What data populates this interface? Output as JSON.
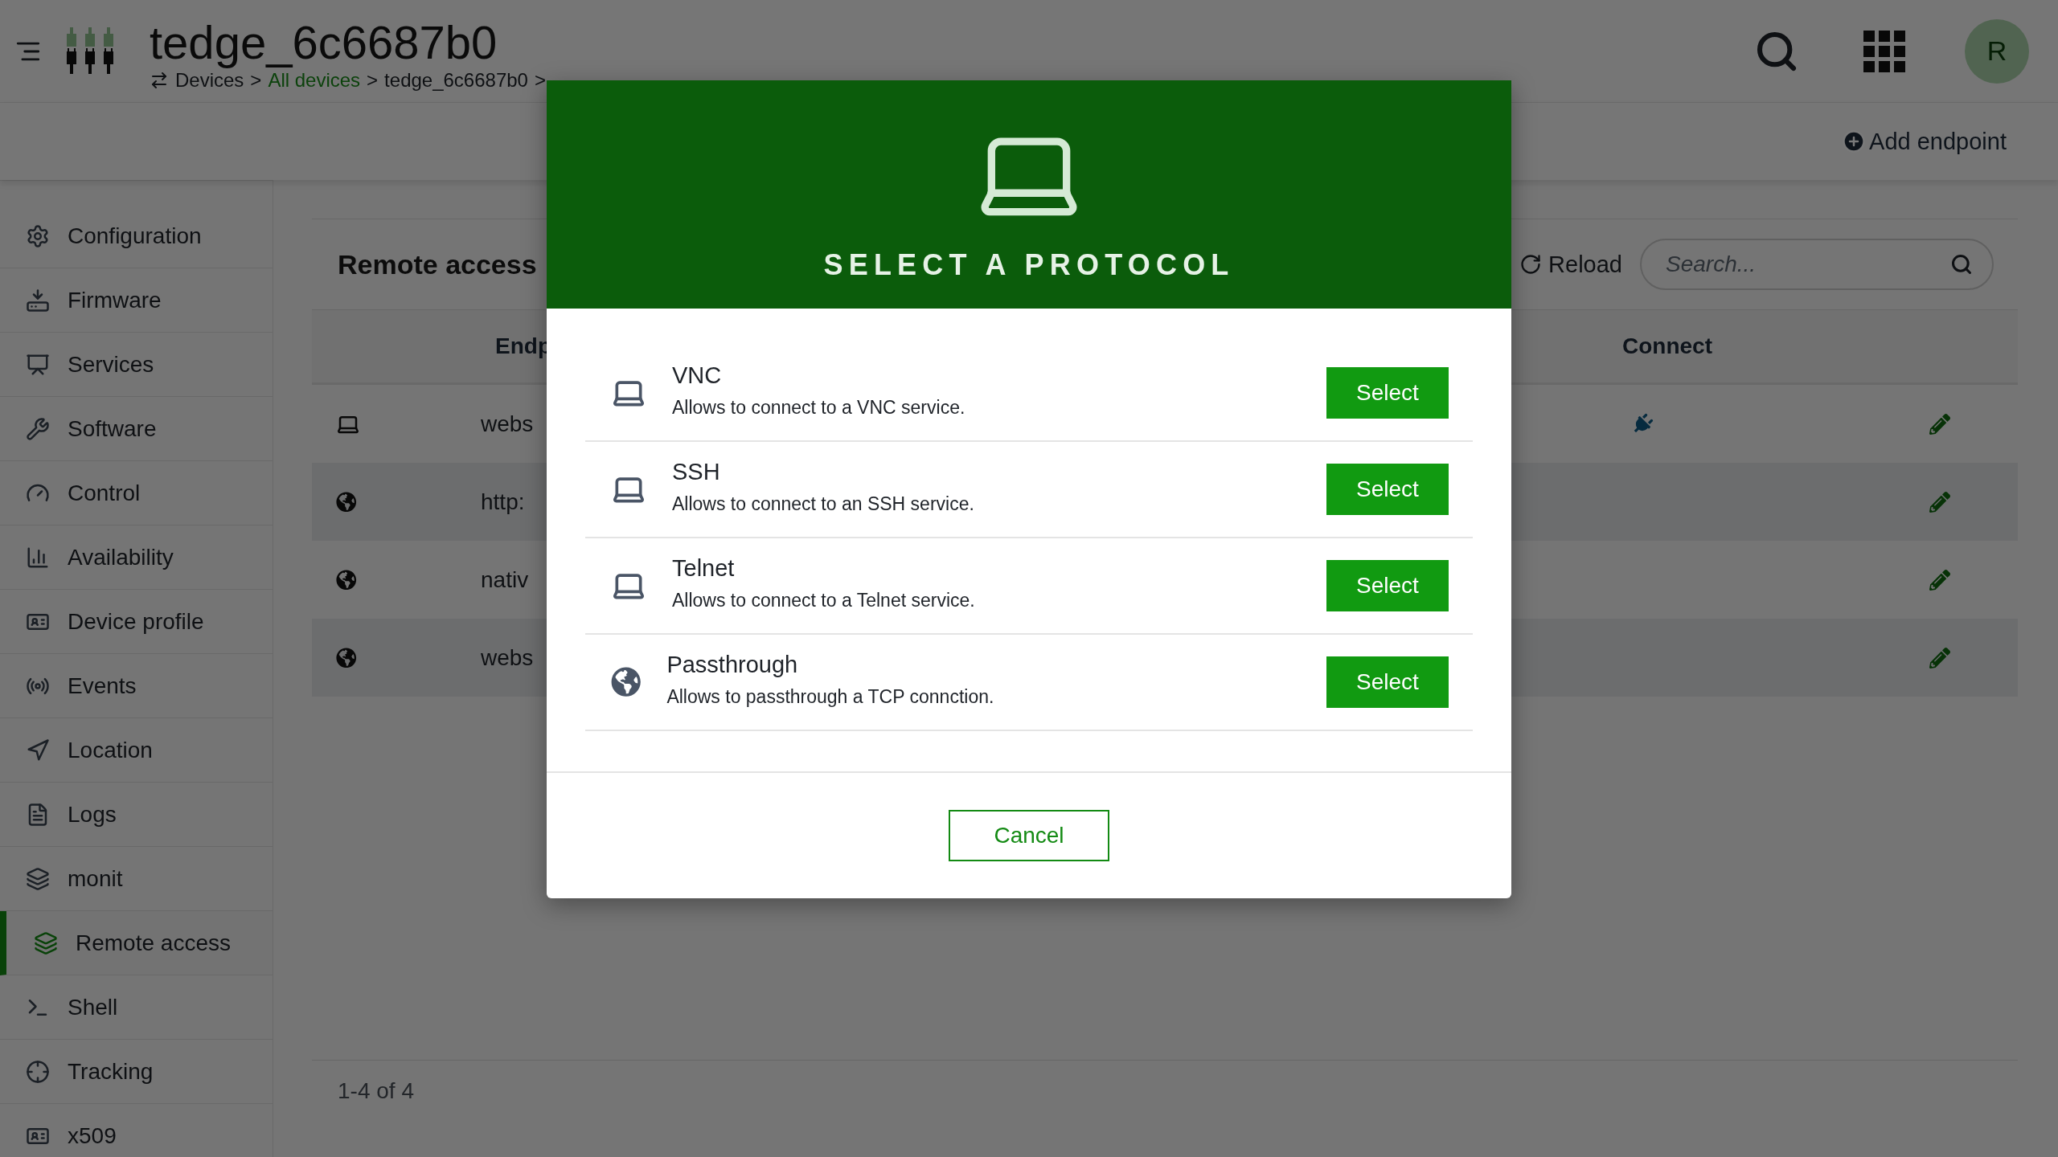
{
  "header": {
    "title": "tedge_6c6687b0",
    "breadcrumb": [
      {
        "kind": "text",
        "label": "Devices"
      },
      {
        "kind": "separator",
        "label": ">"
      },
      {
        "kind": "link",
        "label": "All devices"
      },
      {
        "kind": "separator",
        "label": ">"
      },
      {
        "kind": "text",
        "label": "tedge_6c6687b0"
      },
      {
        "kind": "separator",
        "label": ">"
      }
    ],
    "avatar": "R"
  },
  "toolbar": {
    "add_button": "Add endpoint"
  },
  "sidebar": {
    "items": [
      {
        "label": "Configuration",
        "selected": false
      },
      {
        "label": "Firmware",
        "selected": false
      },
      {
        "label": "Services",
        "selected": false
      },
      {
        "label": "Software",
        "selected": false
      },
      {
        "label": "Control",
        "selected": false
      },
      {
        "label": "Availability",
        "selected": false
      },
      {
        "label": "Device profile",
        "selected": false
      },
      {
        "label": "Events",
        "selected": false
      },
      {
        "label": "Location",
        "selected": false
      },
      {
        "label": "Logs",
        "selected": false
      },
      {
        "label": "monit",
        "selected": false
      },
      {
        "label": "Remote access",
        "selected": true
      },
      {
        "label": "Shell",
        "selected": false
      },
      {
        "label": "Tracking",
        "selected": false
      },
      {
        "label": "x509",
        "selected": false
      }
    ]
  },
  "card": {
    "title": "Remote access",
    "reload": "Reload",
    "search": {
      "placeholder": "Search..."
    },
    "columns": [
      "Endp",
      "Connect"
    ],
    "rows": [
      {
        "kind": "desktop",
        "endpoint": "webs",
        "connectable": true
      },
      {
        "kind": "web",
        "endpoint": "http:",
        "connectable": false
      },
      {
        "kind": "web",
        "endpoint": "nativ",
        "connectable": false
      },
      {
        "kind": "web",
        "endpoint": "webs",
        "connectable": false
      }
    ],
    "footer": "1-4 of 4"
  },
  "dialog": {
    "title": "SELECT A PROTOCOL",
    "protocols": [
      {
        "kind": "desktop",
        "name": "VNC",
        "description": "Allows to connect to a VNC service.",
        "button": "Select"
      },
      {
        "kind": "desktop",
        "name": "SSH",
        "description": "Allows to connect to an SSH service.",
        "button": "Select"
      },
      {
        "kind": "desktop",
        "name": "Telnet",
        "description": "Allows to connect to a Telnet service.",
        "button": "Select"
      },
      {
        "kind": "web",
        "name": "Passthrough",
        "description": "Allows to passthrough a TCP connction.",
        "button": "Select"
      }
    ],
    "cancel": "Cancel"
  }
}
